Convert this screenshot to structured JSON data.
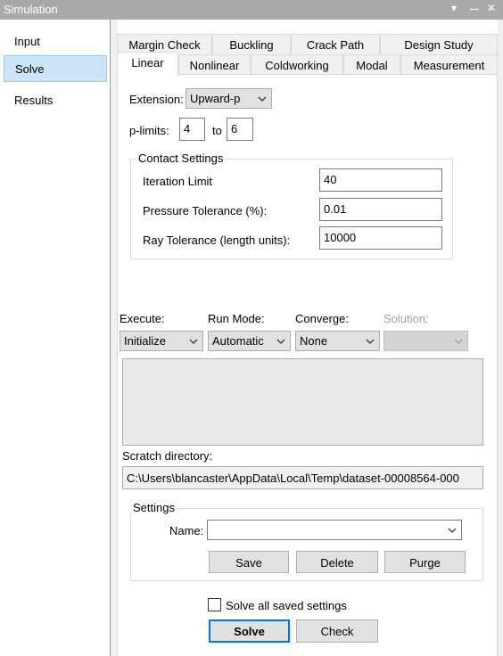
{
  "window": {
    "title": "Simulation",
    "controls": [
      "▾",
      "ꟷ",
      "✕"
    ]
  },
  "sidebar": {
    "items": [
      {
        "label": "Input",
        "selected": false
      },
      {
        "label": "Solve",
        "selected": true
      },
      {
        "label": "Results",
        "selected": false
      }
    ]
  },
  "tabs": {
    "row1": [
      "Margin Check",
      "Buckling",
      "Crack Path",
      "Design Study"
    ],
    "row2": [
      "Linear",
      "Nonlinear",
      "Coldworking",
      "Modal",
      "Measurement"
    ],
    "active": "Linear"
  },
  "extension": {
    "label": "Extension:",
    "value": "Upward-p"
  },
  "plimits": {
    "label": "p-limits:",
    "from": "4",
    "to_label": "to",
    "to": "6"
  },
  "contact": {
    "title": "Contact Settings",
    "iteration_label": "Iteration Limit",
    "iteration_value": "40",
    "pressure_label": "Pressure Tolerance (%):",
    "pressure_value": "0.01",
    "ray_label": "Ray Tolerance (length units):",
    "ray_value": "10000"
  },
  "run": {
    "execute_label": "Execute:",
    "execute_value": "Initialize",
    "runmode_label": "Run Mode:",
    "runmode_value": "Automatic",
    "converge_label": "Converge:",
    "converge_value": "None",
    "solution_label": "Solution:",
    "solution_value": ""
  },
  "scratch": {
    "label": "Scratch directory:",
    "value": "C:\\Users\\blancaster\\AppData\\Local\\Temp\\dataset-00008564-000"
  },
  "settings": {
    "title": "Settings",
    "name_label": "Name:",
    "name_value": "",
    "save": "Save",
    "delete": "Delete",
    "purge": "Purge"
  },
  "solve_all": {
    "label": "Solve all saved settings",
    "checked": false
  },
  "actions": {
    "solve": "Solve",
    "check": "Check"
  },
  "colors": {
    "selection": "#cce4f7",
    "default_button_border": "#0078d7",
    "titlebar": "#a9a9a9"
  }
}
